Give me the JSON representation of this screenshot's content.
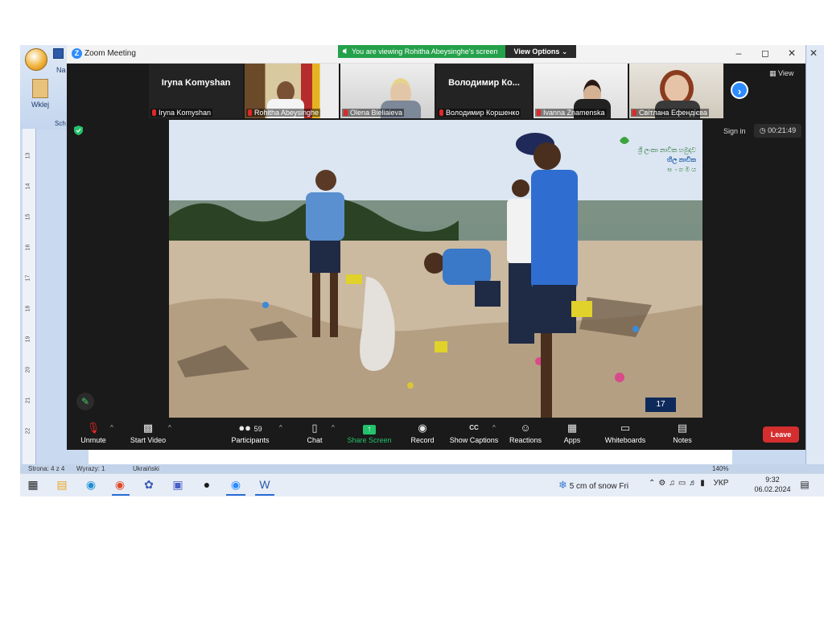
{
  "word": {
    "tab_partial": "Na",
    "paste_label": "Wklej",
    "clipboard_partial": "Sch",
    "ruler_numbers": [
      "13",
      "14",
      "15",
      "16",
      "17",
      "18",
      "19",
      "20",
      "21",
      "22"
    ],
    "status_page": "Strona: 4 z 4",
    "status_words": "Wyrazy: 1",
    "status_lang": "Ukraiński",
    "zoom_level": "140%"
  },
  "zoom": {
    "title": "Zoom Meeting",
    "banner": "You are viewing Rohitha Abeysinghe's screen",
    "view_options": "View Options",
    "view_button": "View",
    "sign_in": "Sign in",
    "timer": "00:21:49",
    "slide_number": "17",
    "participants_in_strip": [
      {
        "display": "Iryna Komyshan",
        "label": "Iryna Komyshan",
        "kind": "name"
      },
      {
        "display": "",
        "label": "Rohitha Abeysinghe",
        "kind": "video"
      },
      {
        "display": "",
        "label": "Olena Bieliaieva",
        "kind": "video"
      },
      {
        "display": "Володимир  Ко...",
        "label": "Володимир Коршенко",
        "kind": "name"
      },
      {
        "display": "",
        "label": "Ivanna Znamenska",
        "kind": "video"
      },
      {
        "display": "",
        "label": "Світлана Ефендієва",
        "kind": "video"
      }
    ],
    "toolbar": {
      "unmute": "Unmute",
      "start_video": "Start Video",
      "participants": "Participants",
      "participants_count": "59",
      "chat": "Chat",
      "share_screen": "Share Screen",
      "record": "Record",
      "show_captions": "Show Captions",
      "reactions": "Reactions",
      "apps": "Apps",
      "whiteboards": "Whiteboards",
      "notes": "Notes",
      "leave": "Leave"
    },
    "logo_text": [
      "ශ්‍රී ලංකා නාවික හමුදාව",
      "හිල නාවික",
      "ස ං ග ම ය"
    ]
  },
  "taskbar": {
    "weather": "5 cm of snow Fri",
    "language": "УКР",
    "time": "9:32",
    "date": "06.02.2024"
  },
  "colors": {
    "zoom_blue": "#2d8cff",
    "banner_green": "#24a14a",
    "leave_red": "#d42e2e",
    "share_green": "#23c26b"
  }
}
